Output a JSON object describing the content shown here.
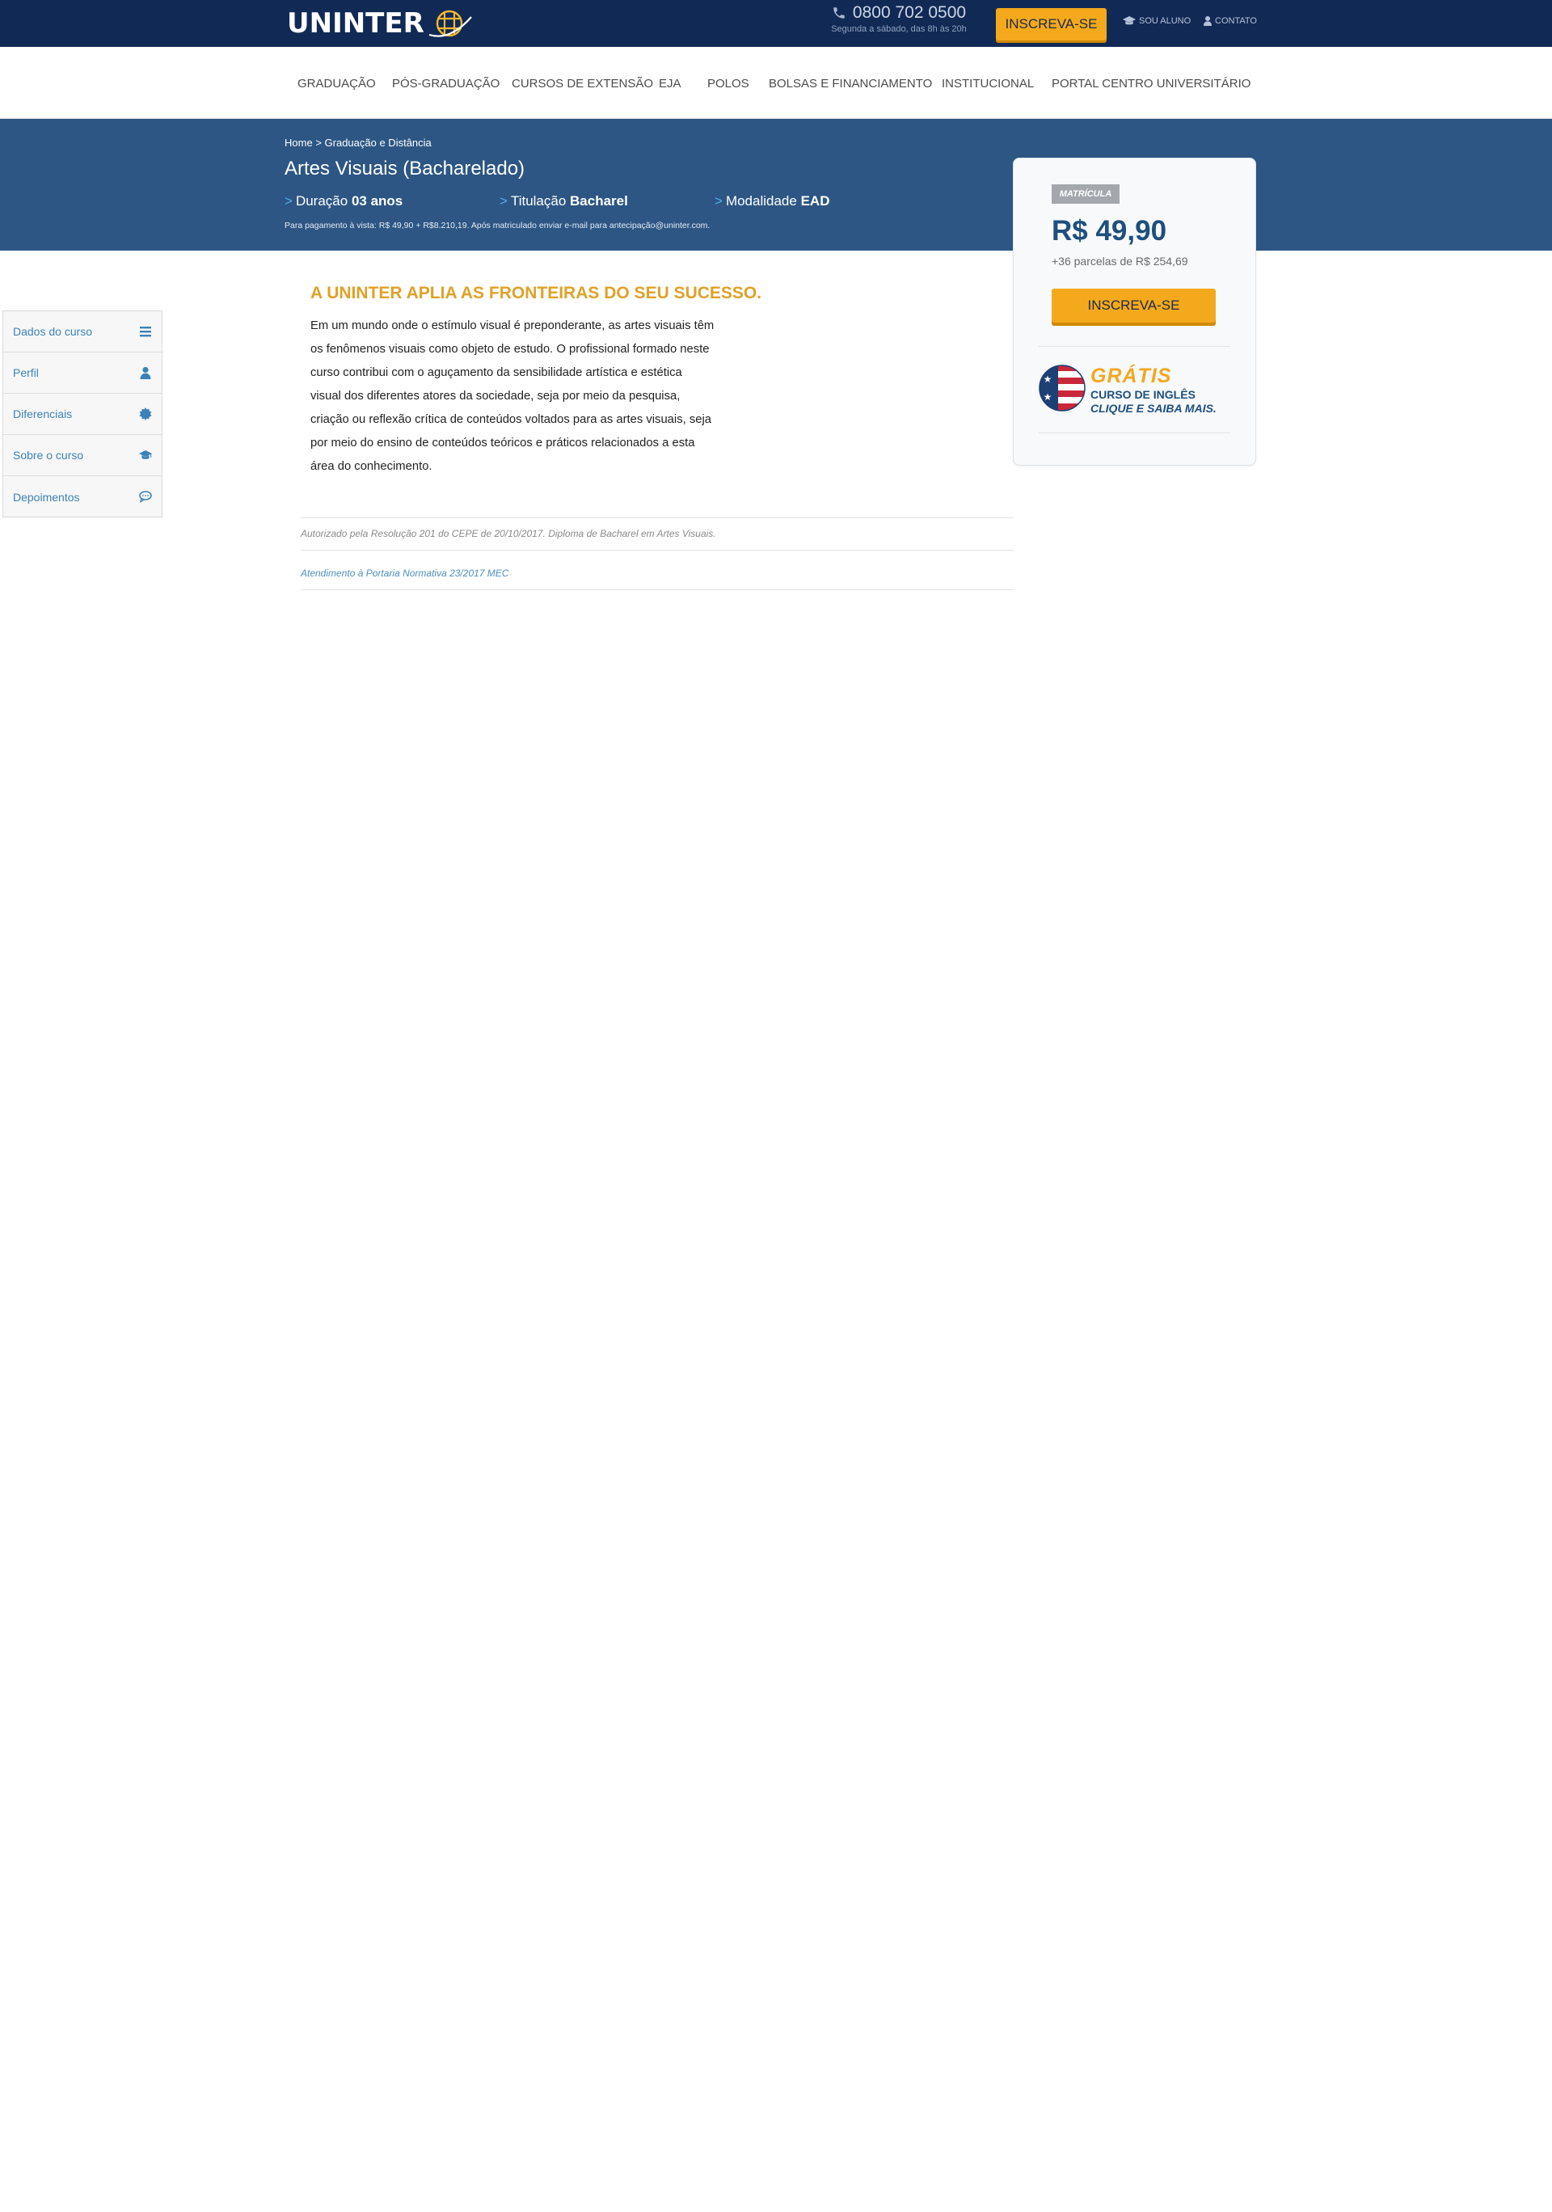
{
  "topbar": {
    "logo": "UNINTER",
    "phone": "0800 702 0500",
    "phone_hours": "Segunda a sábado, das 8h às 20h",
    "signup_button": "INSCREVA-SE",
    "student_link": "SOU ALUNO",
    "contact_link": "CONTATO",
    "colors": {
      "background": "#112a55",
      "accent": "#f4a91c"
    }
  },
  "nav": {
    "items": [
      "GRADUAÇÃO",
      "PÓS-GRADUAÇÃO",
      "CURSOS DE EXTENSÃO",
      "EJA",
      "POLOS",
      "BOLSAS E FINANCIAMENTO",
      "INSTITUCIONAL",
      "PORTAL CENTRO UNIVERSITÁRIO"
    ]
  },
  "hero": {
    "breadcrumb": {
      "home": "Home",
      "separator": ">",
      "current": "Graduação e Distância"
    },
    "title": "Artes Visuais (Bacharelado)",
    "meta": [
      {
        "arrow": ">",
        "label": "Duração",
        "value": "03 anos"
      },
      {
        "arrow": ">",
        "label": "Titulação",
        "value": "Bacharel"
      },
      {
        "arrow": ">",
        "label": "Modalidade",
        "value": "EAD"
      }
    ],
    "payment_note": "Para pagamento à vista: R$ 49,90 + R$8.210,19. Após matriculado enviar e-mail para antecipação@uninter.com.",
    "background_color": "#2d5684"
  },
  "price_card": {
    "badge": "MATRÍCULA",
    "price": "R$ 49,90",
    "installments": "+36 parcelas de R$ 254,69",
    "button": "INSCREVA-SE",
    "promo": {
      "headline": "GRÁTIS",
      "line1": "CURSO DE INGLÊS",
      "line2": "CLIQUE E SAIBA MAIS."
    }
  },
  "sidebar": {
    "items": [
      {
        "label": "Dados do curso",
        "icon": "menu-icon"
      },
      {
        "label": "Perfil",
        "icon": "user-icon"
      },
      {
        "label": "Diferenciais",
        "icon": "badge-icon"
      },
      {
        "label": "Sobre o curso",
        "icon": "graduation-cap-icon"
      },
      {
        "label": "Depoimentos",
        "icon": "comment-icon"
      }
    ]
  },
  "content": {
    "title": "A UNINTER APLIA AS FRONTEIRAS DO SEU SUCESSO.",
    "lines": [
      "Em um mundo onde o estímulo visual é preponderante, as artes visuais têm",
      "os fenômenos visuais como objeto de estudo. O profissional formado neste",
      "curso contribui com o aguçamento da sensibilidade artística e estética",
      "visual dos diferentes atores da sociedade, seja por meio da pesquisa,",
      "criação ou reflexão crítica de conteúdos voltados para as artes visuais, seja",
      "por meio do ensino de conteúdos teóricos e práticos relacionados a esta",
      "área do conhecimento."
    ],
    "authorization": "Autorizado pela Resolução 201 do CEPE de 20/10/2017. Diploma de Bacharel em Artes Visuais.",
    "portaria_link": "Atendimento à Portaria Normativa 23/2017 MEC"
  }
}
